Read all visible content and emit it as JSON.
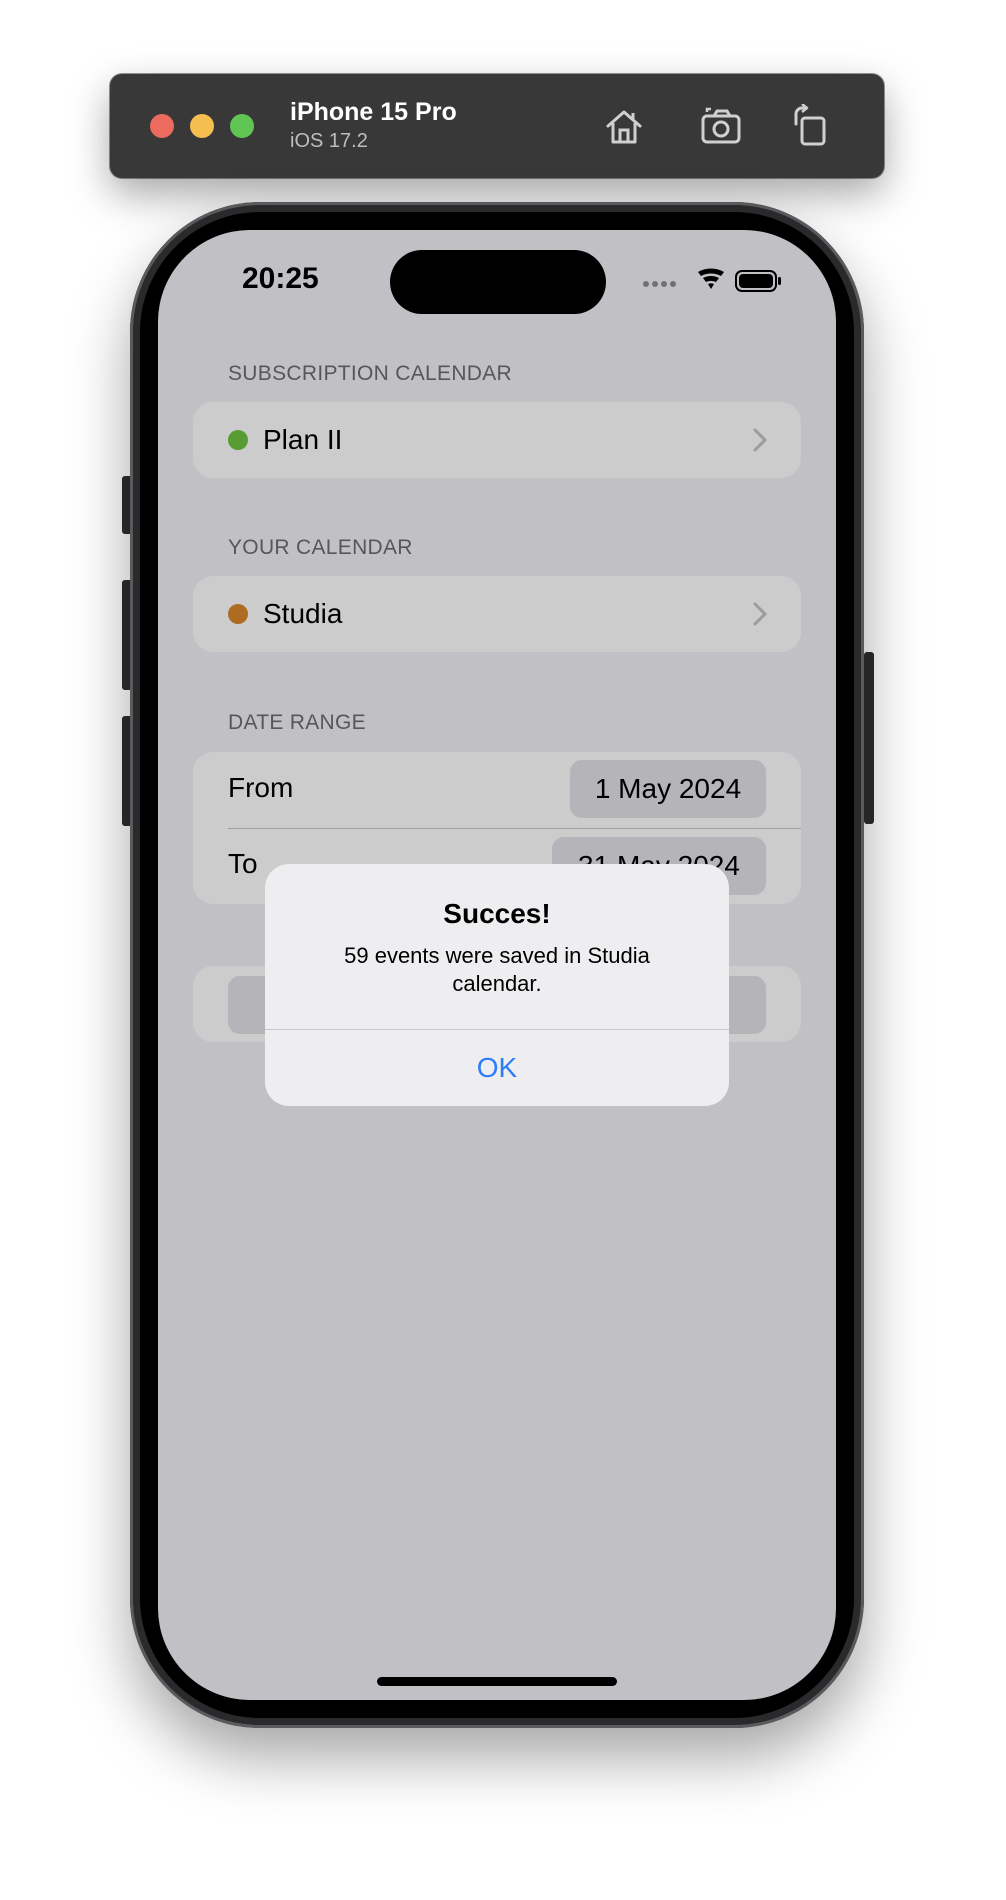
{
  "simulator": {
    "device_name": "iPhone 15 Pro",
    "os_version": "iOS 17.2",
    "buttons": [
      "home-icon",
      "screenshot-icon",
      "rotate-icon"
    ]
  },
  "status_bar": {
    "time": "20:25",
    "icons": [
      "signal-dots-icon",
      "wifi-icon",
      "battery-icon"
    ]
  },
  "sections": {
    "subscription_calendar": {
      "header": "SUBSCRIPTION CALENDAR",
      "item_label": "Plan II",
      "dot_color": "#6fc23f"
    },
    "your_calendar": {
      "header": "YOUR CALENDAR",
      "item_label": "Studia",
      "dot_color": "#d9882a"
    },
    "date_range": {
      "header": "DATE RANGE",
      "from_label": "From",
      "from_value": "1 May 2024",
      "to_label": "To",
      "to_value": "31 May 2024"
    }
  },
  "alert": {
    "title": "Succes!",
    "message": "59 events were saved in Studia calendar.",
    "ok_label": "OK"
  },
  "colors": {
    "accent": "#2e7cf6",
    "background": "#f2f2f7"
  }
}
